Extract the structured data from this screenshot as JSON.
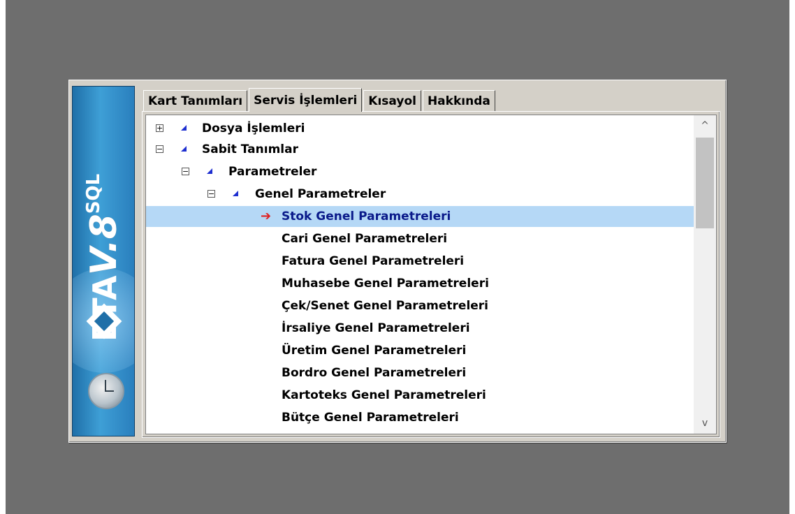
{
  "logo": {
    "eta": "ETA",
    "version": "V.8",
    "sql": "SQL"
  },
  "tabs": [
    {
      "label": "Kart Tanımları",
      "active": false
    },
    {
      "label": "Servis İşlemleri",
      "active": true
    },
    {
      "label": "Kısayol",
      "active": false
    },
    {
      "label": "Hakkında",
      "active": false
    }
  ],
  "tree": {
    "items": [
      {
        "label": "Dosya İşlemleri",
        "expander": "+"
      },
      {
        "label": "Sabit Tanımlar",
        "expander": "−"
      },
      {
        "label": "Parametreler",
        "expander": "−"
      },
      {
        "label": "Genel Parametreler",
        "expander": "−"
      },
      {
        "label": "Stok Genel Parametreleri",
        "selected": true
      },
      {
        "label": "Cari Genel Parametreleri"
      },
      {
        "label": "Fatura Genel Parametreleri"
      },
      {
        "label": "Muhasebe Genel Parametreleri"
      },
      {
        "label": "Çek/Senet Genel Parametreleri"
      },
      {
        "label": "İrsaliye Genel Parametreleri"
      },
      {
        "label": "Üretim Genel Parametreleri"
      },
      {
        "label": "Bordro Genel Parametreleri"
      },
      {
        "label": "Kartoteks  Genel Parametreleri"
      },
      {
        "label": "Bütçe Genel Parametreleri"
      }
    ]
  },
  "scrollbar": {
    "up": "^",
    "down": "v"
  },
  "colors": {
    "selection": "#b5d8f6",
    "selected_text": "#0a1a8a",
    "arrow": "#e02020",
    "triangle": "#1e2fd0"
  }
}
